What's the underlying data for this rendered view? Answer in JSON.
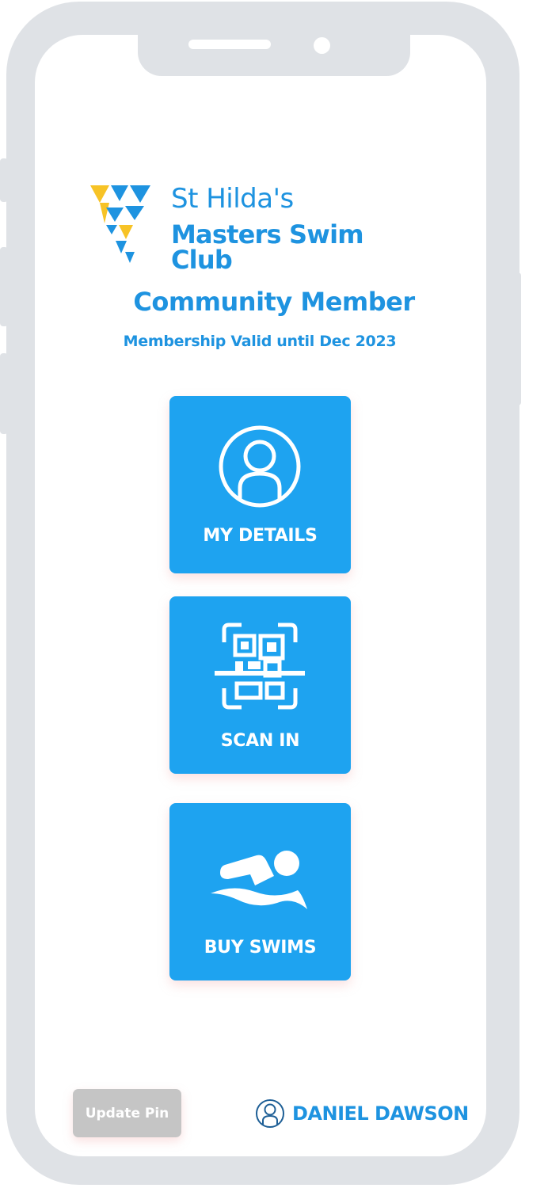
{
  "logo": {
    "line1": "St Hilda's",
    "line2": "Masters Swim Club"
  },
  "membership": {
    "type": "Community Member",
    "validity": "Membership Valid until Dec 2023"
  },
  "tiles": [
    {
      "label": "MY DETAILS",
      "icon": "user-circle-icon"
    },
    {
      "label": "SCAN IN",
      "icon": "qr-scan-icon"
    },
    {
      "label": "BUY SWIMS",
      "icon": "swimmer-icon"
    }
  ],
  "footer": {
    "update_pin_label": "Update Pin",
    "user_name": "DANIEL DAWSON",
    "user_icon": "user-circle-icon"
  },
  "colors": {
    "brand_blue": "#1e93e0",
    "tile_blue": "#1ea3f0",
    "logo_yellow": "#f7c326",
    "disabled_gray": "#c5c5c5",
    "frame_gray": "#dfe2e6"
  }
}
